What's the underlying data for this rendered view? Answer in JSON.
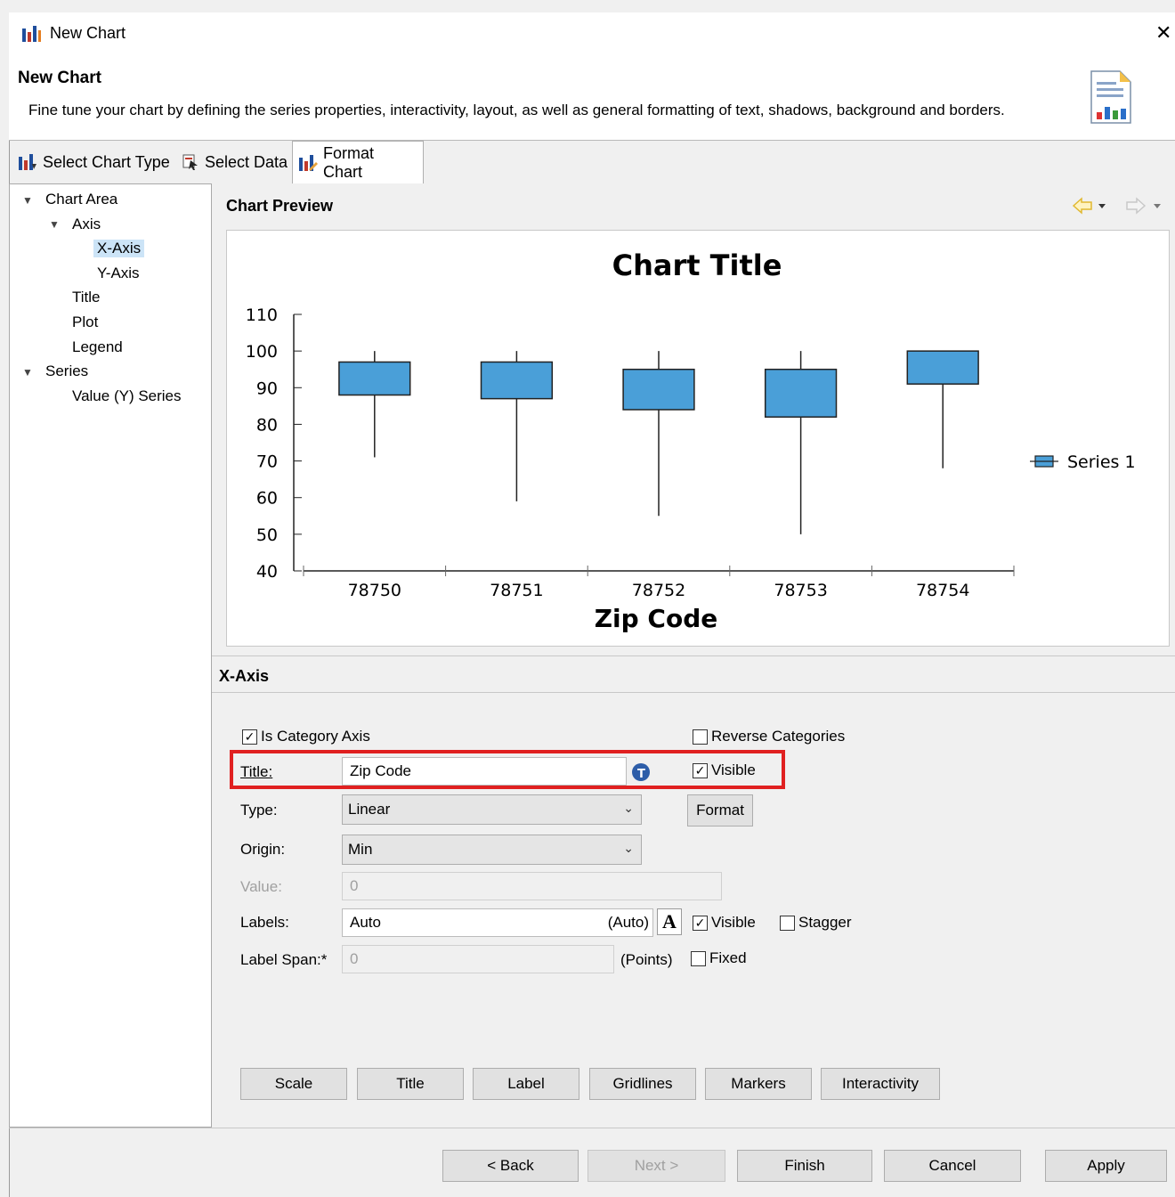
{
  "window": {
    "title": "New Chart",
    "close_glyph": "✕"
  },
  "header": {
    "title": "New Chart",
    "description": "Fine tune your chart by defining the series properties, interactivity, layout, as well as general formatting of text, shadows, background and borders."
  },
  "tabs": [
    {
      "label": "Select Chart Type",
      "icon": "chart-type-icon"
    },
    {
      "label": "Select Data",
      "icon": "select-data-icon"
    },
    {
      "label": "Format Chart",
      "icon": "format-chart-icon",
      "active": true
    }
  ],
  "tree": {
    "items": [
      {
        "label": "Chart Area",
        "level": 0,
        "expanded": true
      },
      {
        "label": "Axis",
        "level": 1,
        "expanded": true
      },
      {
        "label": "X-Axis",
        "level": 2,
        "selected": true
      },
      {
        "label": "Y-Axis",
        "level": 2
      },
      {
        "label": "Title",
        "level": 1
      },
      {
        "label": "Plot",
        "level": 1
      },
      {
        "label": "Legend",
        "level": 1
      },
      {
        "label": "Series",
        "level": 0,
        "expanded": true
      },
      {
        "label": "Value (Y) Series",
        "level": 1
      }
    ]
  },
  "preview": {
    "heading": "Chart Preview"
  },
  "chart_data": {
    "type": "stock",
    "title": "Chart Title",
    "xlabel": "Zip Code",
    "ylabel": "",
    "categories": [
      "78750",
      "78751",
      "78752",
      "78753",
      "78754"
    ],
    "ylim": [
      40,
      110
    ],
    "yticks": [
      40,
      50,
      60,
      70,
      80,
      90,
      100,
      110
    ],
    "series": [
      {
        "name": "Series 1",
        "color": "#4a9fd8",
        "points": [
          {
            "high": 100,
            "low": 71,
            "open": 97,
            "close": 88
          },
          {
            "high": 100,
            "low": 59,
            "open": 97,
            "close": 87
          },
          {
            "high": 100,
            "low": 55,
            "open": 95,
            "close": 84
          },
          {
            "high": 100,
            "low": 50,
            "open": 95,
            "close": 82
          },
          {
            "high": 100,
            "low": 68,
            "open": 100,
            "close": 91
          }
        ]
      }
    ],
    "legend": "right",
    "grid": false
  },
  "props": {
    "heading": "X-Axis",
    "is_category_axis": {
      "label": "Is Category Axis",
      "checked": true
    },
    "reverse_categories": {
      "label": "Reverse Categories",
      "checked": false
    },
    "title": {
      "label": "Title:",
      "value": "Zip Code",
      "visible_label": "Visible",
      "visible": true
    },
    "type": {
      "label": "Type:",
      "value": "Linear",
      "format_label": "Format"
    },
    "origin": {
      "label": "Origin:",
      "value": "Min"
    },
    "value": {
      "label": "Value:",
      "value": "0"
    },
    "labels": {
      "label": "Labels:",
      "value": "Auto",
      "suffix": "(Auto)",
      "font_glyph": "A",
      "visible_label": "Visible",
      "visible": true,
      "stagger_label": "Stagger",
      "stagger": false
    },
    "label_span": {
      "label": "Label Span:*",
      "value": "0",
      "suffix": "(Points)",
      "fixed_label": "Fixed",
      "fixed": false
    }
  },
  "subbuttons": [
    "Scale",
    "Title",
    "Label",
    "Gridlines",
    "Markers",
    "Interactivity"
  ],
  "footer": {
    "back": "< Back",
    "next": "Next >",
    "finish": "Finish",
    "cancel": "Cancel",
    "apply": "Apply"
  },
  "colors": {
    "box_fill": "#4a9fd8",
    "selection": "#cce4f7",
    "highlight": "#e02020",
    "nav_arrow": "#e0b830"
  }
}
